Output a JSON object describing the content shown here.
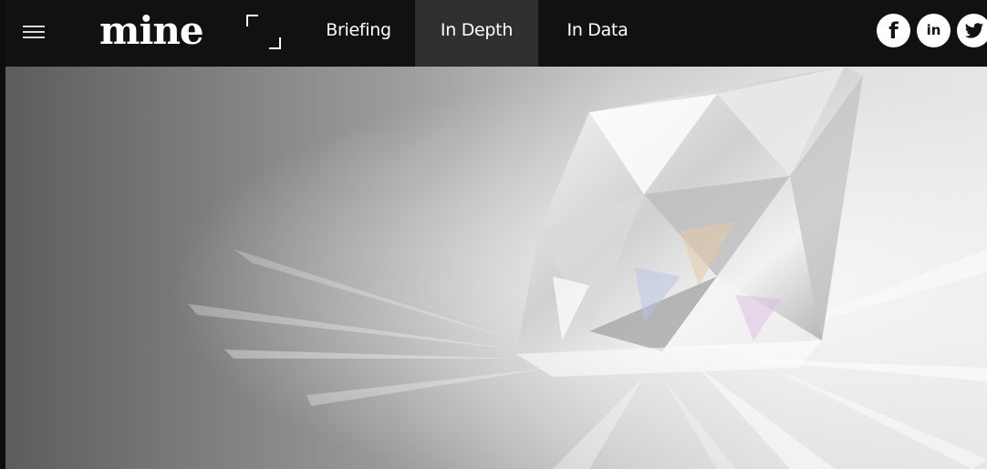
{
  "header": {
    "logo_text": "mine",
    "nav": [
      {
        "label": "Briefing",
        "active": false
      },
      {
        "label": "In Depth",
        "active": true
      },
      {
        "label": "In Data",
        "active": false
      }
    ],
    "social": [
      {
        "icon": "facebook-icon",
        "glyph": "f"
      },
      {
        "icon": "linkedin-icon",
        "glyph": "in"
      },
      {
        "icon": "twitter-icon",
        "glyph": ""
      }
    ],
    "menu_icon": "hamburger-menu-icon",
    "expand_icon": "expand-icon"
  },
  "colors": {
    "topbar": "#111111",
    "active_tab": "#2f2f2f",
    "text": "#ffffff"
  }
}
